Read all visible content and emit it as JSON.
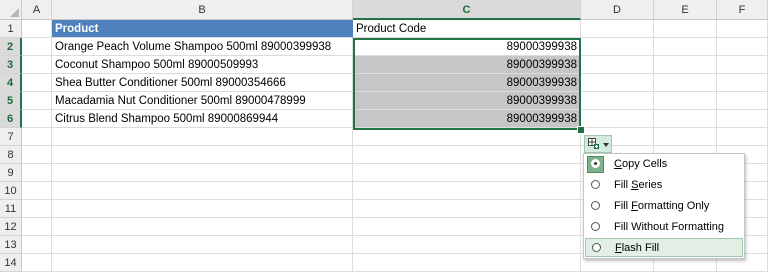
{
  "columns": [
    "A",
    "B",
    "C",
    "D",
    "E",
    "F"
  ],
  "selected_column": "C",
  "rows": [
    "1",
    "2",
    "3",
    "4",
    "5",
    "6",
    "7",
    "8",
    "9",
    "10",
    "11",
    "12",
    "13",
    "14"
  ],
  "selected_rows": [
    "2",
    "3",
    "4",
    "5",
    "6"
  ],
  "sheet": {
    "header": {
      "product": "Product",
      "product_code": "Product Code"
    },
    "data": [
      {
        "product": "Orange Peach Volume Shampoo 500ml 89000399938",
        "code": "89000399938"
      },
      {
        "product": "Coconut Shampoo 500ml 89000509993",
        "code": "89000399938"
      },
      {
        "product": "Shea Butter Conditioner 500ml 89000354666",
        "code": "89000399938"
      },
      {
        "product": "Macadamia Nut Conditioner 500ml 89000478999",
        "code": "89000399938"
      },
      {
        "product": "Citrus Blend Shampoo 500ml 89000869944",
        "code": "89000399938"
      }
    ]
  },
  "autofill_menu": {
    "button_icon": "auto-fill-options-icon",
    "items": [
      {
        "label": "Copy Cells",
        "checked": true,
        "hover": false
      },
      {
        "label": "Fill Series",
        "checked": false,
        "hover": false
      },
      {
        "label": "Fill Formatting Only",
        "checked": false,
        "hover": false
      },
      {
        "label": "Fill Without Formatting",
        "checked": false,
        "hover": false
      },
      {
        "label": "Flash Fill",
        "checked": false,
        "hover": true
      }
    ]
  },
  "colors": {
    "header_fill": "#4f81bd",
    "selection": "#217346",
    "filled_cells": "#c6c6c6"
  }
}
